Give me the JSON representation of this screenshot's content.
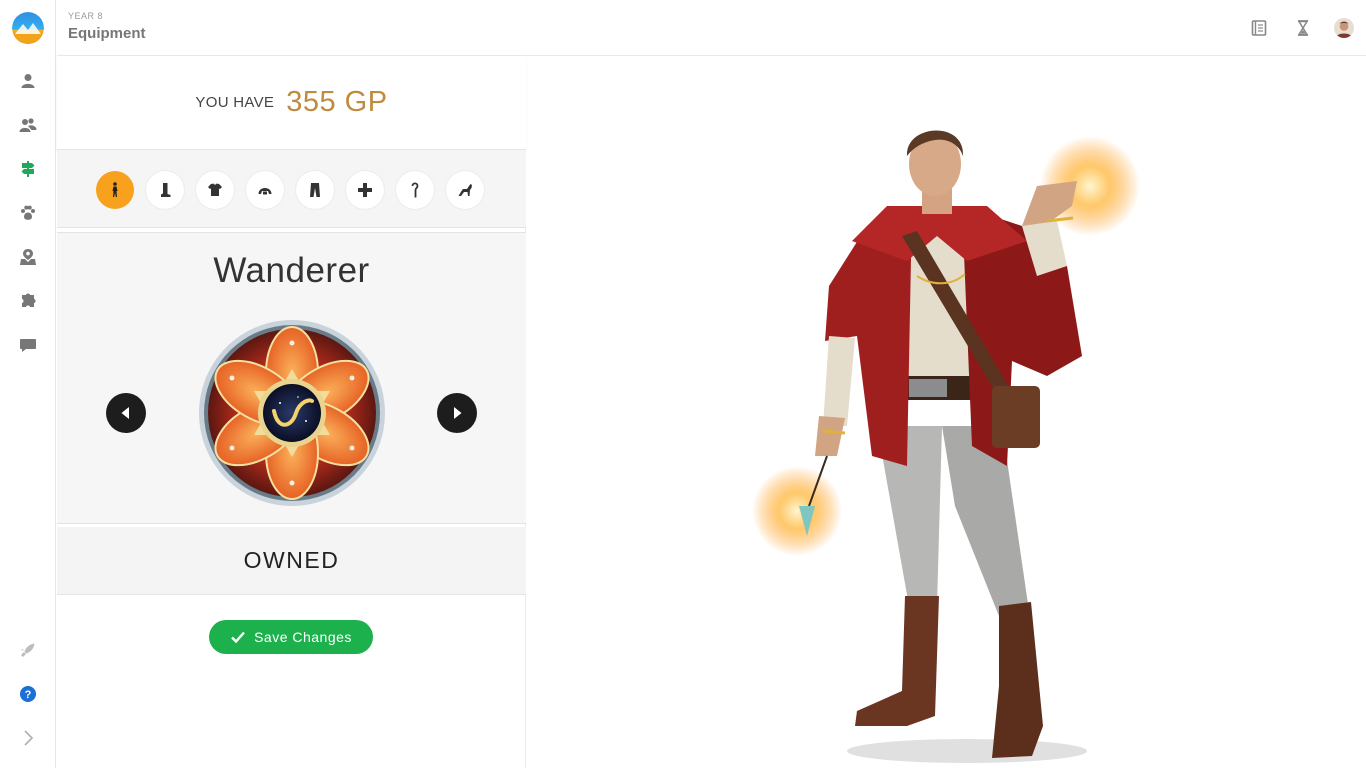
{
  "header": {
    "subtitle": "YEAR 8",
    "title": "Equipment"
  },
  "sidebar": {
    "items": [
      {
        "icon": "user-icon"
      },
      {
        "icon": "users-icon"
      },
      {
        "icon": "signpost-icon",
        "active": true
      },
      {
        "icon": "paw-icon"
      },
      {
        "icon": "map-pin-icon"
      },
      {
        "icon": "puzzle-icon"
      },
      {
        "icon": "chat-icon"
      }
    ],
    "bottom": [
      {
        "icon": "rocket-icon"
      },
      {
        "icon": "help-icon"
      },
      {
        "icon": "chevron-right-icon"
      }
    ]
  },
  "top_right_icons": [
    "book-icon",
    "hourglass-icon",
    "profile-avatar"
  ],
  "gold": {
    "label": "YOU HAVE",
    "amount": "355 GP"
  },
  "categories": [
    {
      "icon": "character-icon",
      "active": true
    },
    {
      "icon": "boot-icon"
    },
    {
      "icon": "shirt-icon"
    },
    {
      "icon": "helmet-icon"
    },
    {
      "icon": "pants-icon"
    },
    {
      "icon": "emblem-icon"
    },
    {
      "icon": "wand-icon"
    },
    {
      "icon": "pet-icon"
    }
  ],
  "item": {
    "name": "Wanderer",
    "status": "OWNED"
  },
  "actions": {
    "save_label": "Save Changes"
  },
  "colors": {
    "accent": "#f7a11c",
    "gold": "#c08b3e",
    "save": "#1cb14c",
    "active_nav": "#1ea85a"
  }
}
